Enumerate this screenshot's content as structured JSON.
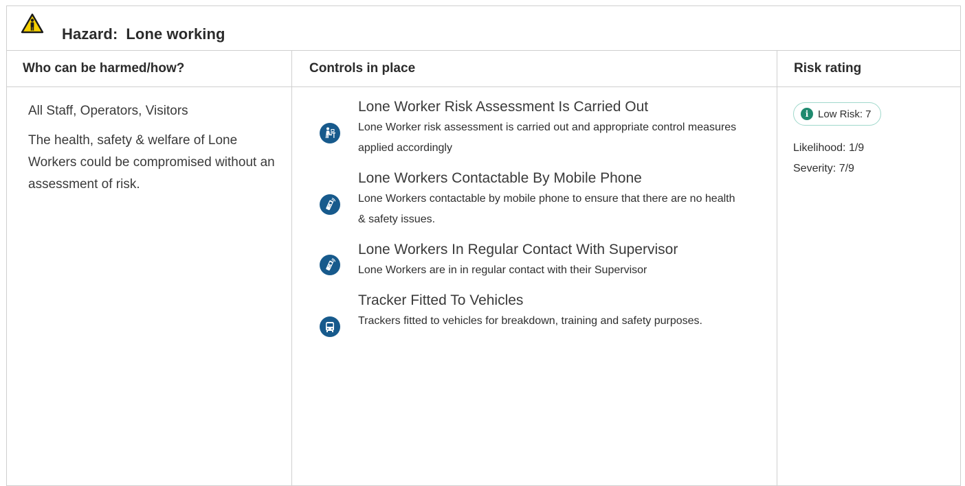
{
  "hazard": {
    "label": "Hazard:",
    "name": "Lone working",
    "icon": "warning-triangle-icon",
    "icon_color": "#f5d000"
  },
  "columns": {
    "who": "Who can be harmed/how?",
    "controls": "Controls in place",
    "risk": "Risk rating"
  },
  "who": {
    "people": "All Staff, Operators, Visitors",
    "description": "The health, safety & welfare of Lone Workers could be compromised without an assessment of risk."
  },
  "controls": [
    {
      "title": "Lone Worker Risk Assessment Is Carried Out",
      "description": "Lone Worker risk assessment is carried out and appropriate control measures applied accordingly",
      "icon": "person-at-desk-icon"
    },
    {
      "title": "Lone Workers Contactable By Mobile Phone",
      "description": "Lone Workers contactable by mobile phone to ensure that there are no health & safety issues.",
      "icon": "mobile-phone-icon"
    },
    {
      "title": "Lone Workers In Regular Contact With Supervisor",
      "description": "Lone Workers are in in regular contact with their Supervisor",
      "icon": "mobile-phone-icon"
    },
    {
      "title": "Tracker Fitted To Vehicles",
      "description": "Trackers fitted to vehicles for breakdown, training and safety purposes.",
      "icon": "bus-icon"
    }
  ],
  "risk": {
    "badge": "Low Risk: 7",
    "badge_icon": "info-icon",
    "badge_color": "#1f8a6f",
    "likelihood": "Likelihood: 1/9",
    "severity": "Severity: 7/9"
  },
  "colors": {
    "icon_bg": "#175a8c",
    "border": "#cfcfcf"
  }
}
